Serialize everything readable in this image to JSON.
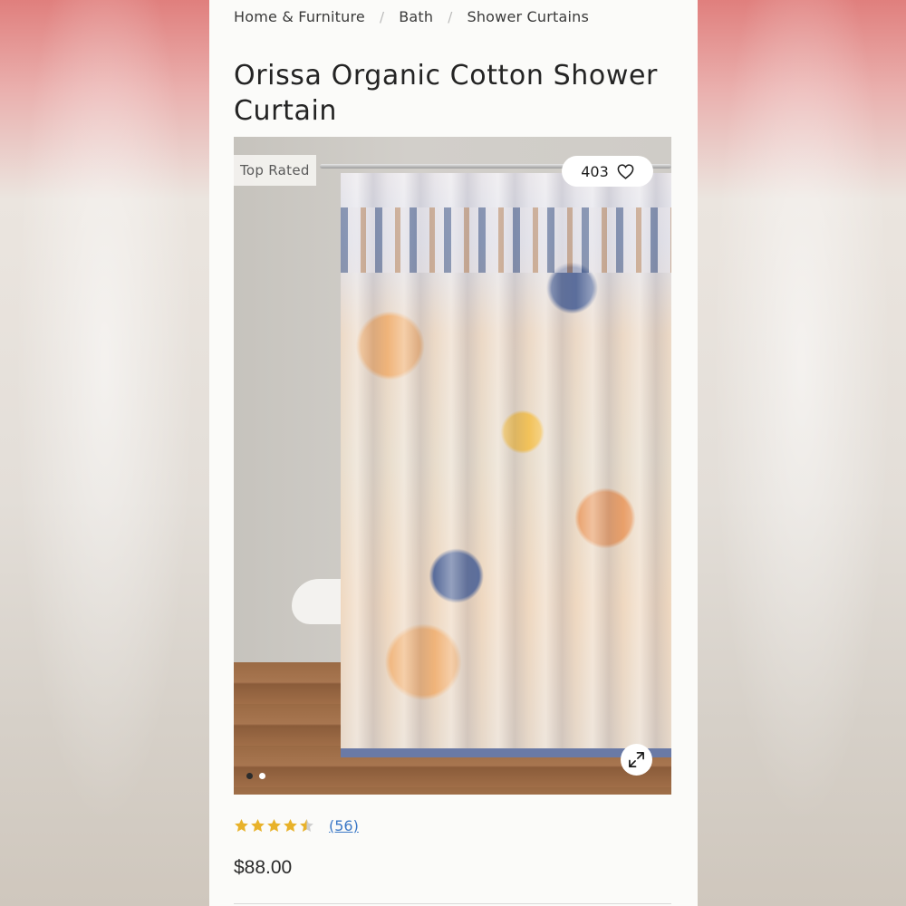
{
  "breadcrumb": {
    "items": [
      "Home & Furniture",
      "Bath",
      "Shower Curtains"
    ],
    "separator": "/"
  },
  "product": {
    "title": "Orissa Organic Cotton Shower Curtain",
    "badge": "Top Rated",
    "favorites_count": "403",
    "rating_value": 4.5,
    "rating_max": 5,
    "review_count_label": "(56)",
    "price": "$88.00"
  },
  "gallery": {
    "image_count": 2,
    "active_index": 0
  },
  "icons": {
    "favorite": "heart-outline-icon",
    "expand": "expand-arrows-icon",
    "star": "star-icon"
  },
  "colors": {
    "star_fill": "#e8b22a",
    "star_empty": "#cfcfcf",
    "link": "#3b78c6",
    "text": "#242424"
  }
}
